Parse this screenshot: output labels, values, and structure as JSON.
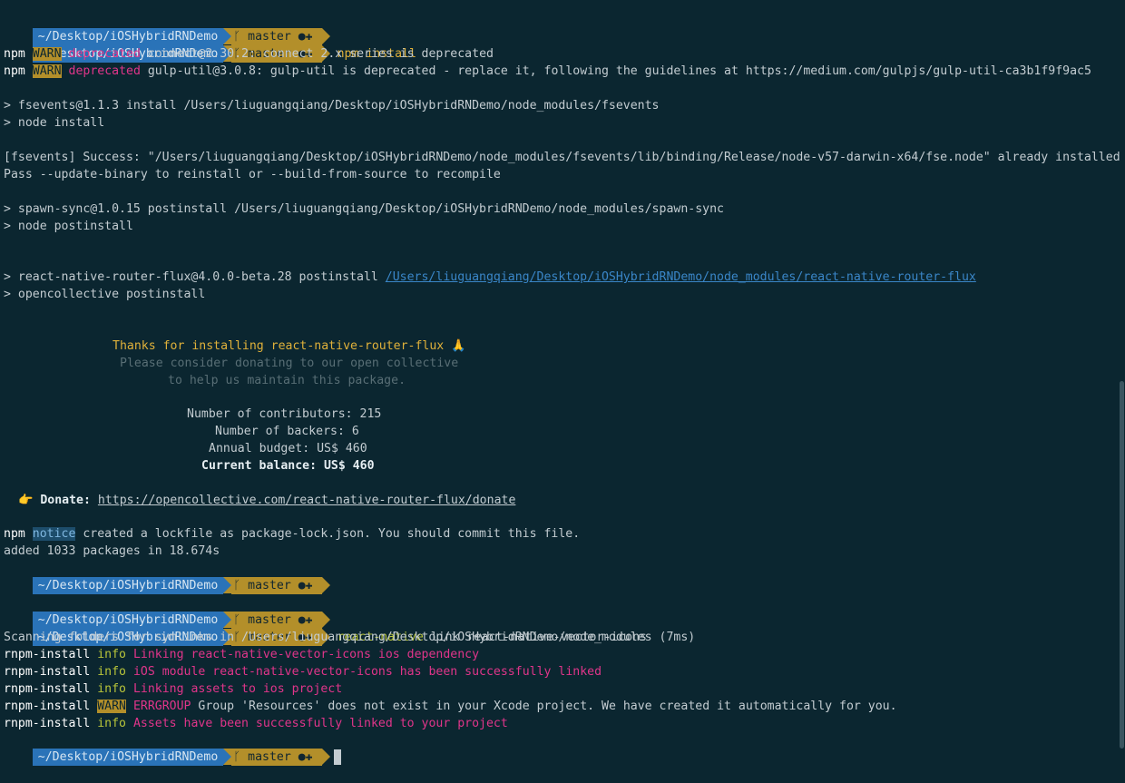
{
  "prompt": {
    "path": "~/Desktop/iOSHybridRNDemo",
    "branch_icon": "ᚴ",
    "branch": "master",
    "status": "●✚"
  },
  "lines": {
    "l2_cmd": "npm install",
    "l3": {
      "pre": "npm",
      "tag": "WARN",
      "kw": "deprecated",
      "msg": " connect@2.30.2: connect 2.x series is deprecated"
    },
    "l4": {
      "pre": "npm",
      "tag": "WARN",
      "kw": "deprecated",
      "msg": " gulp-util@3.0.8: gulp-util is deprecated - replace it, following the guidelines at https://medium.com/gulpjs/gulp-util-ca3b1f9f9ac5"
    },
    "l6": "> fsevents@1.1.3 install /Users/liuguangqiang/Desktop/iOSHybridRNDemo/node_modules/fsevents",
    "l7": "> node install",
    "l9": "[fsevents] Success: \"/Users/liuguangqiang/Desktop/iOSHybridRNDemo/node_modules/fsevents/lib/binding/Release/node-v57-darwin-x64/fse.node\" already installed",
    "l10": "Pass --update-binary to reinstall or --build-from-source to recompile",
    "l12": "> spawn-sync@1.0.15 postinstall /Users/liuguangqiang/Desktop/iOSHybridRNDemo/node_modules/spawn-sync",
    "l13": "> node postinstall",
    "l16_pre": "> react-native-router-flux@4.0.0-beta.28 postinstall ",
    "l16_link": "/Users/liuguangqiang/Desktop/iOSHybridRNDemo/node_modules/react-native-router-flux",
    "l17": "> opencollective postinstall",
    "thanks": "Thanks for installing react-native-router-flux 🙏",
    "please": "Please consider donating to our open collective",
    "help": "to help us maintain this package.",
    "contrib": "Number of contributors: 215",
    "backers": "Number of backers: 6",
    "budget": "Annual budget: US$ 460",
    "balance": "Current balance: US$ 460",
    "donate_label": "👉 Donate:",
    "donate_url": "https://opencollective.com/react-native-router-flux/donate",
    "notice": {
      "pre": "npm",
      "tag": "notice",
      "msg": " created a lockfile as package-lock.json. You should commit this file."
    },
    "added": "added 1033 packages in 18.674s",
    "link_cmd": {
      "kw": "react-native",
      "rest": " link react-native-vector-icons"
    },
    "scanning": "Scanning folders for symlinks in /Users/liuguangqiang/Desktop/iOSHybridRNDemo/node_modules (7ms)",
    "r1": {
      "pre": "rnpm-install",
      "tag": "info",
      "msg": "Linking react-native-vector-icons ios dependency"
    },
    "r2": {
      "pre": "rnpm-install",
      "tag": "info",
      "msg": "iOS module react-native-vector-icons has been successfully linked"
    },
    "r3": {
      "pre": "rnpm-install",
      "tag": "info",
      "msg": "Linking assets to ios project"
    },
    "r4": {
      "pre": "rnpm-install",
      "tag": "WARN",
      "kw": "ERRGROUP",
      "msg": " Group 'Resources' does not exist in your Xcode project. We have created it automatically for you."
    },
    "r5": {
      "pre": "rnpm-install",
      "tag": "info",
      "msg": "Assets have been successfully linked to your project"
    }
  }
}
